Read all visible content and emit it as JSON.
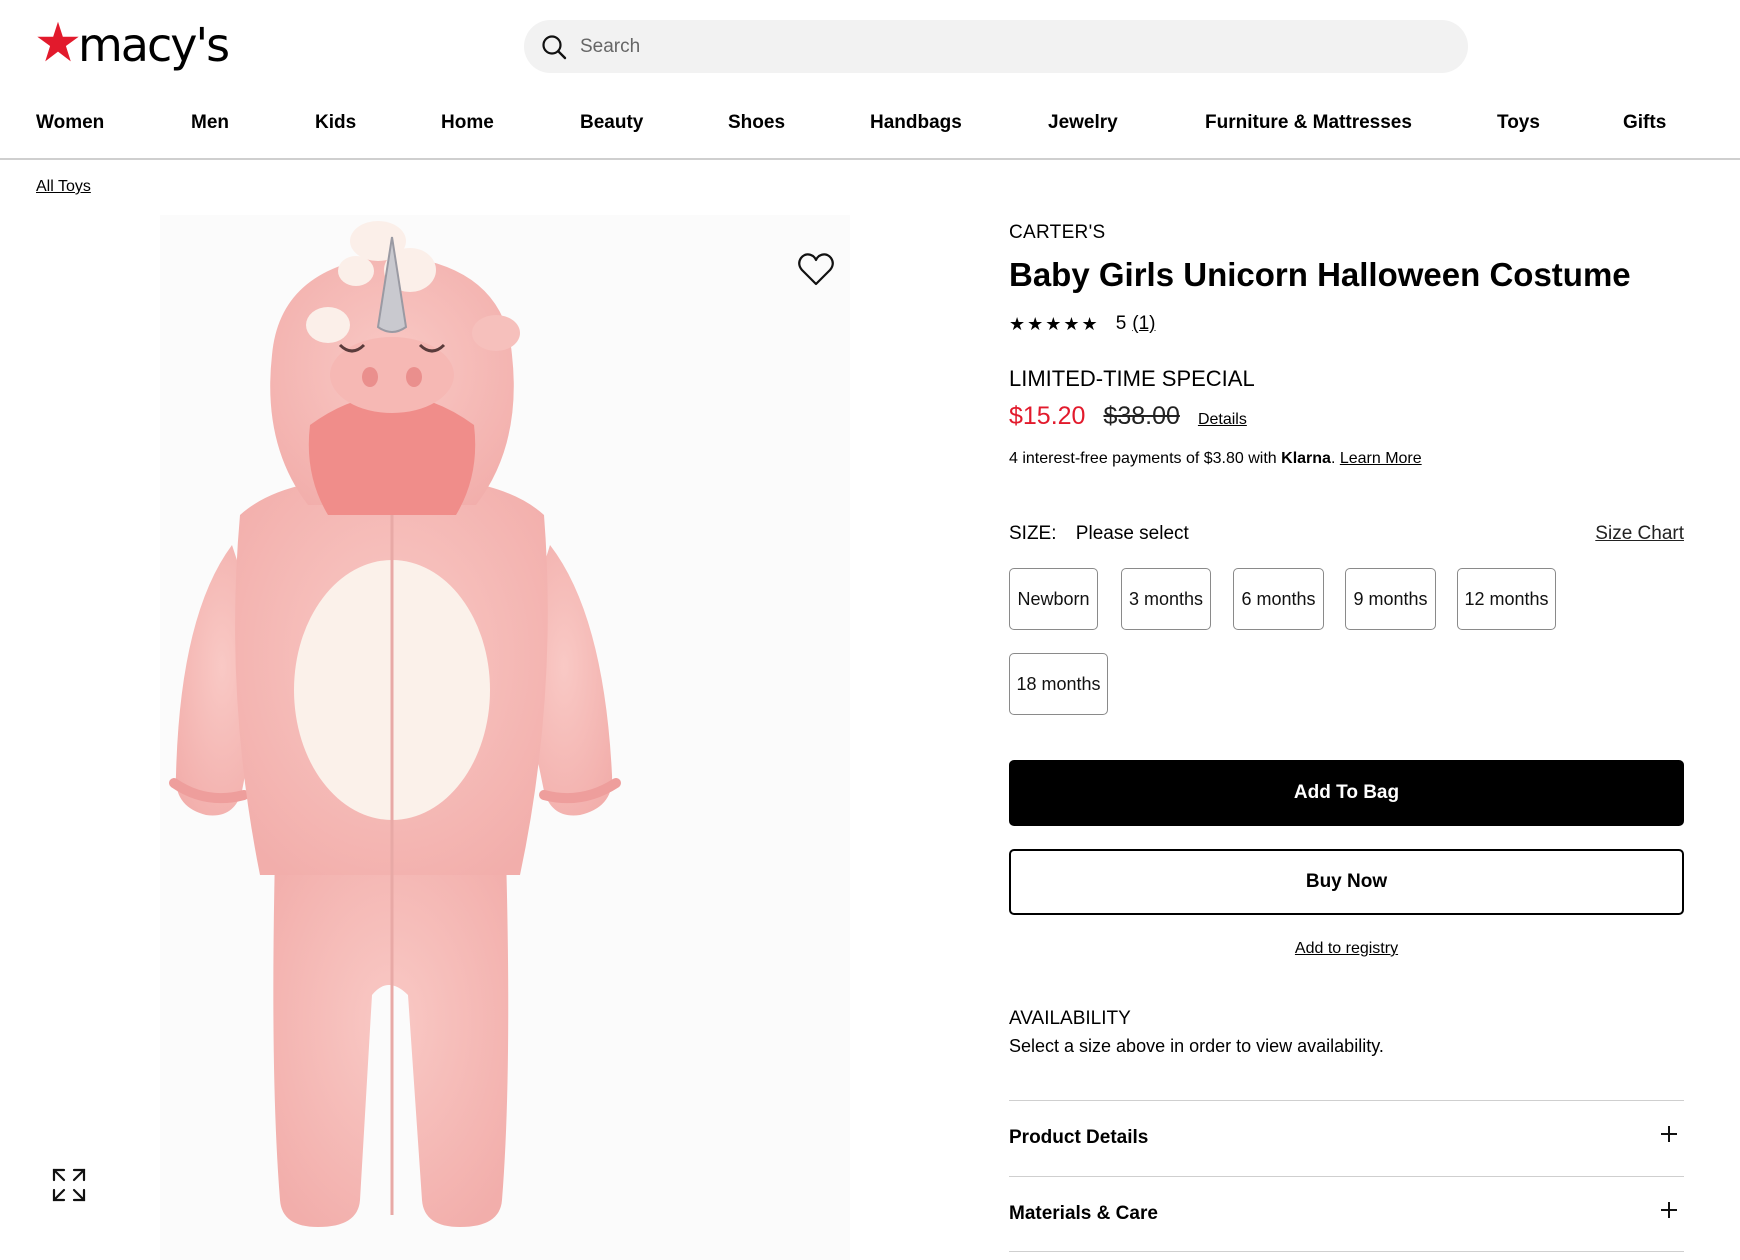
{
  "brand_logo": {
    "text": "macy's",
    "accent": "#e21a2c"
  },
  "search": {
    "placeholder": "Search",
    "value": "",
    "icon": "search-icon"
  },
  "nav": {
    "items": [
      "Women",
      "Men",
      "Kids",
      "Home",
      "Beauty",
      "Shoes",
      "Handbags",
      "Jewelry",
      "Furniture & Mattresses",
      "Toys",
      "Gifts"
    ]
  },
  "breadcrumb": {
    "label": "All Toys"
  },
  "gallery": {
    "wishlist_icon": "heart-icon",
    "expand_icon": "expand-icon"
  },
  "product": {
    "brand": "CARTER'S",
    "title": "Baby Girls Unicorn Halloween Costume",
    "rating": {
      "stars": "★★★★★",
      "value": "5",
      "count": "(1)"
    },
    "promo_label": "LIMITED-TIME SPECIAL",
    "sale_price": "$15.20",
    "original_price": "$38.00",
    "details_link": "Details",
    "sale_color": "#e21a2c",
    "klarna": {
      "prefix": "4 interest-free payments of $3.80 with ",
      "brand": "Klarna",
      "suffix": ". ",
      "learn_more": "Learn More"
    }
  },
  "size": {
    "label": "SIZE:",
    "selected": "Please select",
    "chart_link": "Size Chart",
    "options": [
      "Newborn",
      "3 months",
      "6 months",
      "9 months",
      "12 months",
      "18 months"
    ]
  },
  "actions": {
    "add_to_bag": "Add To Bag",
    "buy_now": "Buy Now",
    "add_to_registry": "Add to registry"
  },
  "availability": {
    "title": "AVAILABILITY",
    "text": "Select a size above in order to view availability."
  },
  "accordions": [
    "Product Details",
    "Materials & Care"
  ]
}
